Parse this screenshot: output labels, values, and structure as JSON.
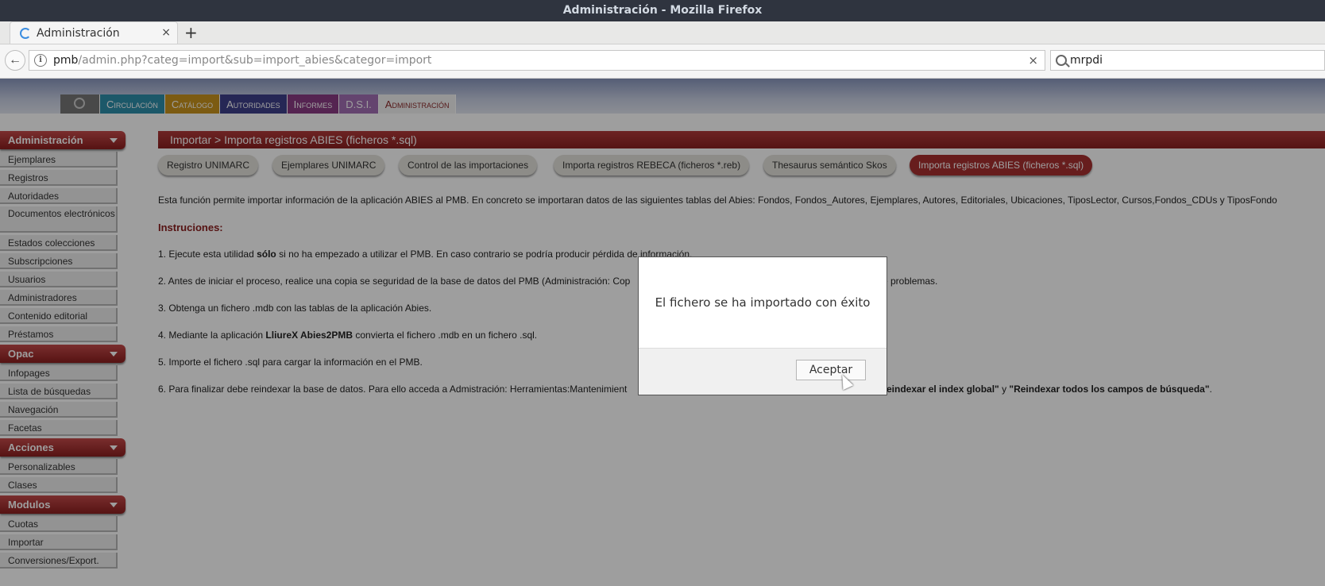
{
  "window": {
    "title": "Administración - Mozilla Firefox"
  },
  "tab": {
    "label": "Administración",
    "close": "×",
    "new_tab": "+"
  },
  "nav": {
    "url_host": "pmb",
    "url_path": "/admin.php?categ=import&sub=import_abies&categor=import",
    "url_clear": "×",
    "search_value": "mrpdi"
  },
  "mainnav": {
    "items": [
      "Circulación",
      "Catálogo",
      "Autoridades",
      "Informes",
      "D.S.I.",
      "Administración"
    ]
  },
  "sidebar": {
    "sections": [
      {
        "title": "Administración",
        "items": [
          "Ejemplares",
          "Registros",
          "Autoridades",
          "Documentos electrónicos",
          "Estados colecciones",
          "Subscripciones",
          "Usuarios",
          "Administradores",
          "Contenido editorial",
          "Préstamos"
        ]
      },
      {
        "title": "Opac",
        "items": [
          "Infopages",
          "Lista de búsquedas",
          "Navegación",
          "Facetas"
        ]
      },
      {
        "title": "Acciones",
        "items": [
          "Personalizables",
          "Clases"
        ]
      },
      {
        "title": "Modulos",
        "items": [
          "Cuotas",
          "Importar",
          "Conversiones/Export."
        ]
      }
    ]
  },
  "content": {
    "breadcrumb": "Importar > Importa registros ABIES (ficheros *.sql)",
    "subtabs": [
      "Registro UNIMARC",
      "Ejemplares UNIMARC",
      "Control de las importaciones",
      "Importa registros REBECA (ficheros *.reb)",
      "Thesaurus semántico Skos",
      "Importa registros ABIES (ficheros *.sql)"
    ],
    "intro": "Esta función permite importar información de la aplicación ABIES al PMB. En concreto se importaran datos de las siguientes tablas del Abies: Fondos, Fondos_Autores, Ejemplares, Autores, Editoriales, Ubicaciones, TiposLector, Cursos,Fondos_CDUs y TiposFondo",
    "instructions_title": "Instruciones:",
    "step1_a": "1. Ejecute esta utilidad ",
    "step1_b": "sólo",
    "step1_c": " si no ha empezado a utilizar el PMB. En caso contrario se podría producir pérdida de información.",
    "step2": "2. Antes de iniciar el proceso, realice una copia se seguridad de la base de datos del PMB (Administración: Cop",
    "step2_end": "e problemas.",
    "step3": "3. Obtenga un fichero .mdb con las tablas de la aplicación Abies.",
    "step4_a": "4. Mediante la aplicación ",
    "step4_b": "LliureX Abies2PMB",
    "step4_c": " convierta el fichero .mdb en un fichero .sql.",
    "step5": "5. Importe el fichero .sql para cargar la información en el PMB.",
    "step6_a": "6. Para finalizar debe reindexar la base de datos. Para ello acceda a Admistración: Herramientas:Mantenimient",
    "step6_b": "eindexar el index global\"",
    "step6_c": " y ",
    "step6_d": "\"Reindexar todos los campos de búsqueda\"",
    "step6_e": "."
  },
  "dialog": {
    "message": "El fichero se ha importado con éxito",
    "button": "Aceptar"
  }
}
